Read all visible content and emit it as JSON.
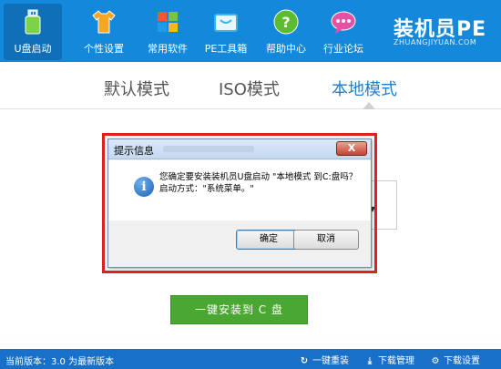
{
  "toolbar": {
    "items": [
      {
        "label": "U盘启动",
        "icon": "usb-icon",
        "color": "#2e9be6"
      },
      {
        "label": "个性设置",
        "icon": "tshirt-icon",
        "color": "#f6a623"
      },
      {
        "label": "常用软件",
        "icon": "windows-tiles-icon",
        "color": "#f05a28"
      },
      {
        "label": "PE工具箱",
        "icon": "toolbox-icon",
        "color": "#3db4e8"
      },
      {
        "label": "帮助中心",
        "icon": "help-icon",
        "color": "#5cbb2e"
      },
      {
        "label": "行业论坛",
        "icon": "chat-icon",
        "color": "#e651a5"
      }
    ],
    "brand": "装机员PE",
    "brand_sub": "ZHUANGJIYUAN.COM"
  },
  "tabs": [
    {
      "label": "默认模式",
      "active": false
    },
    {
      "label": "ISO模式",
      "active": false
    },
    {
      "label": "本地模式",
      "active": true
    }
  ],
  "dialog": {
    "title": "提示信息",
    "close": "X",
    "message_line1": "您确定要安装装机员U盘启动 \"本地模式 到C:盘吗？",
    "message_line2": "启动方式：\"系统菜单。\"",
    "ok": "确定",
    "cancel": "取消"
  },
  "install_button": "一键安装到 C 盘",
  "status": {
    "version": "当前版本：3.0 为最新版本",
    "reinstall": "一键重装",
    "download_manager": "下载管理",
    "download_settings": "下载设置"
  },
  "colors": {
    "toolbar_bg": "#1488db",
    "tab_active": "#1f7fd0",
    "highlight": "#e0201f",
    "install_btn": "#4aa832",
    "statusbar_bg": "#1870c8"
  }
}
